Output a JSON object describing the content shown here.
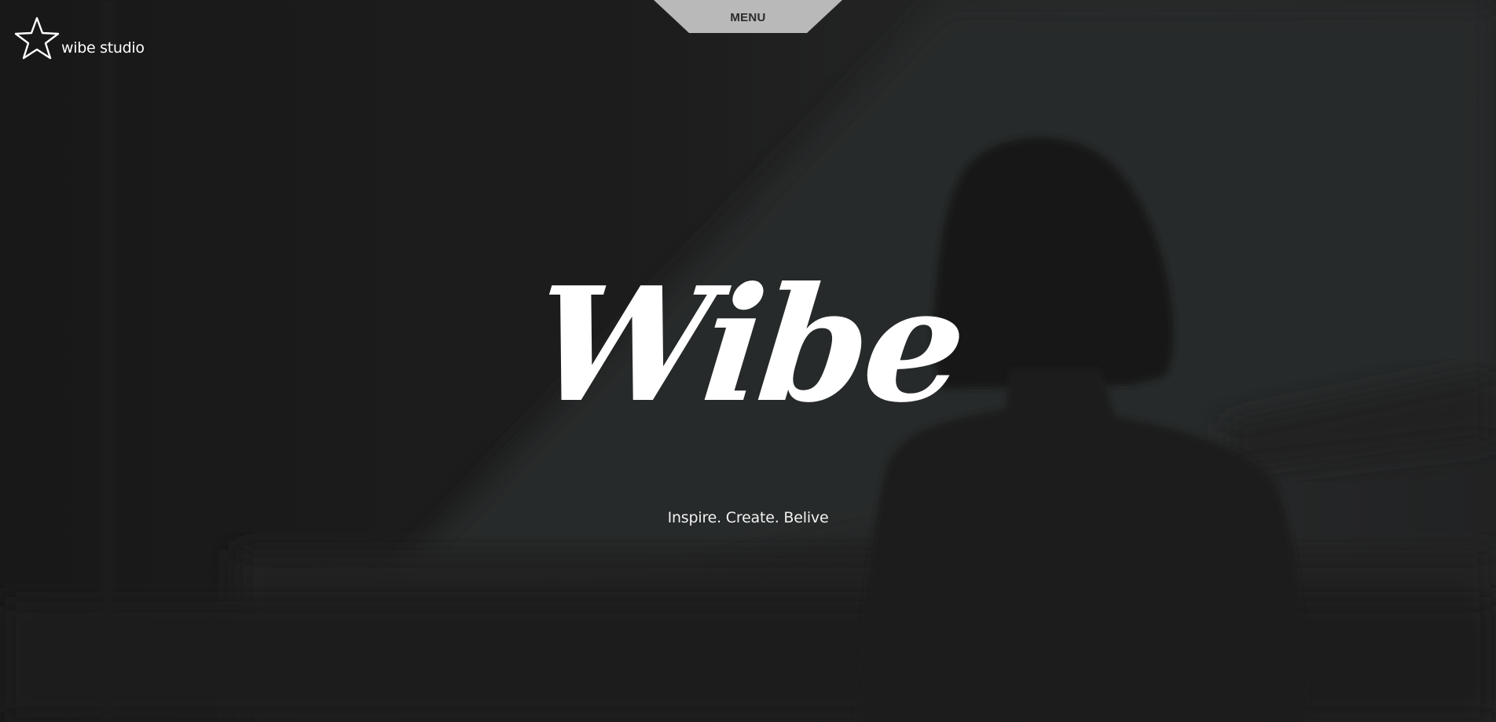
{
  "nav": {
    "menu_label": "MENU"
  },
  "brand": {
    "name": "wibe studio",
    "icon": "star-icon"
  },
  "hero": {
    "title": "Wibe",
    "tagline": "Inspire. Create. Belive"
  },
  "colors": {
    "background": "#1e1e1e",
    "menu_tab": "#b9b9b9",
    "text": "#ffffff"
  }
}
